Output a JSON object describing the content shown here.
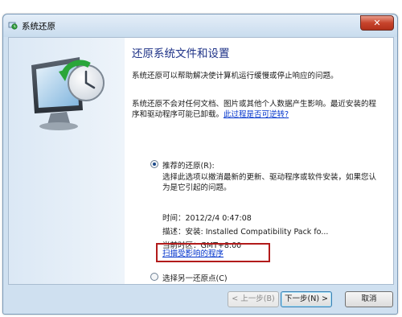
{
  "window": {
    "title": "系统还原"
  },
  "heading": "还原系统文件和设置",
  "para1": "系统还原可以帮助解决使计算机运行缓慢或停止响应的问题。",
  "para2_text": "系统还原不会对任何文档、图片或其他个人数据产生影响。最近安装的程序和驱动程序可能已卸载。",
  "para2_link": "此过程是否可逆转?",
  "recommended": {
    "label": "推荐的还原(R):",
    "desc": "选择此选项以撤消最新的更新、驱动程序或软件安装，如果您认为是它引起的问题。",
    "time_label": "时间：",
    "time_value": "2012/2/4 0:47:08",
    "desc_label": "描述：",
    "desc_value": "安装: Installed Compatibility Pack fo...",
    "tz_label": "当前时区：",
    "tz_value": "GMT+8:00",
    "affected_link": "扫描受影响的程序"
  },
  "other": {
    "label": "选择另一还原点(C)"
  },
  "buttons": {
    "prev": "< 上一步(B)",
    "next": "下一步(N) >",
    "cancel": "取消"
  },
  "icons": {
    "app": "system-restore-icon",
    "hero": "system-restore-monitor-icon"
  }
}
